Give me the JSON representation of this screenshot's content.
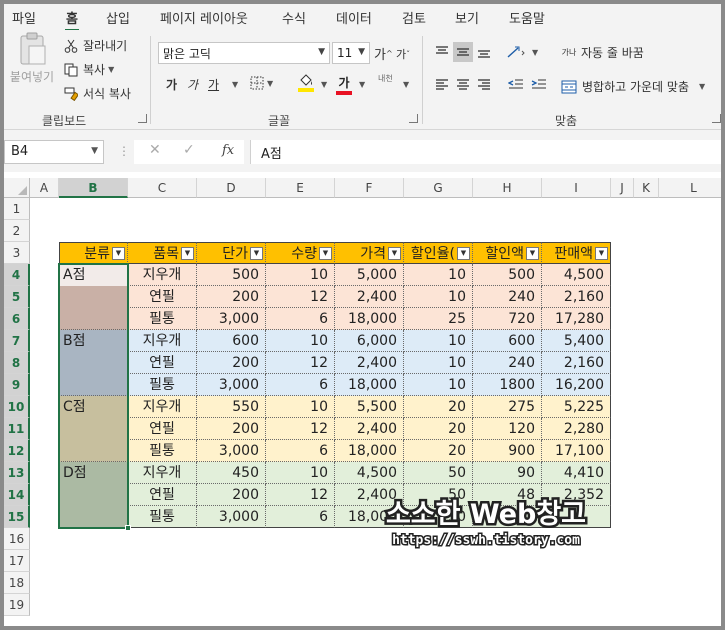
{
  "menu": {
    "tabs": [
      "파일",
      "홈",
      "삽입",
      "페이지 레이아웃",
      "수식",
      "데이터",
      "검토",
      "보기",
      "도움말"
    ],
    "active": "홈"
  },
  "ribbon": {
    "clipboard": {
      "paste_label": "붙여넣기",
      "cut_label": "잘라내기",
      "copy_label": "복사",
      "format_painter_label": "서식 복사",
      "group_label": "클립보드"
    },
    "font": {
      "font_name": "맑은 고딕",
      "font_size": "11",
      "grow_label": "가",
      "shrink_label": "가",
      "bold_label": "가",
      "italic_label": "가",
      "underline_label": "가",
      "font_color_label": "가",
      "phonetic_label": "내천",
      "group_label": "글꼴",
      "fill_color": "#ffe600",
      "font_color": "#e81123"
    },
    "alignment": {
      "wrap_label": "자동 줄 바꿈",
      "merge_label": "병합하고 가운데 맞춤",
      "wrap_icon_text": "가나",
      "group_label": "맞춤"
    }
  },
  "formula_bar": {
    "name_box": "B4",
    "fx_label": "fx",
    "formula": "A점"
  },
  "columns": [
    "A",
    "B",
    "C",
    "D",
    "E",
    "F",
    "G",
    "H",
    "I",
    "J",
    "K",
    "L"
  ],
  "selected_column": "B",
  "rows": [
    "1",
    "2",
    "3",
    "4",
    "5",
    "6",
    "7",
    "8",
    "9",
    "10",
    "11",
    "12",
    "13",
    "14",
    "15",
    "16",
    "17",
    "18",
    "19"
  ],
  "selected_rows": [
    "4",
    "5",
    "6",
    "7",
    "8",
    "9",
    "10",
    "11",
    "12",
    "13",
    "14",
    "15"
  ],
  "table": {
    "headers": [
      "분류",
      "품목",
      "단가",
      "수량",
      "가격",
      "할인율(",
      "할인액",
      "판매액"
    ],
    "rows": [
      [
        "A점",
        "지우개",
        "500",
        "10",
        "5,000",
        "10",
        "500",
        "4,500"
      ],
      [
        "",
        "연필",
        "200",
        "12",
        "2,400",
        "10",
        "240",
        "2,160"
      ],
      [
        "",
        "필통",
        "3,000",
        "6",
        "18,000",
        "25",
        "720",
        "17,280"
      ],
      [
        "B점",
        "지우개",
        "600",
        "10",
        "6,000",
        "10",
        "600",
        "5,400"
      ],
      [
        "",
        "연필",
        "200",
        "12",
        "2,400",
        "10",
        "240",
        "2,160"
      ],
      [
        "",
        "필통",
        "3,000",
        "6",
        "18,000",
        "10",
        "1800",
        "16,200"
      ],
      [
        "C점",
        "지우개",
        "550",
        "10",
        "5,500",
        "20",
        "275",
        "5,225"
      ],
      [
        "",
        "연필",
        "200",
        "12",
        "2,400",
        "20",
        "120",
        "2,280"
      ],
      [
        "",
        "필통",
        "3,000",
        "6",
        "18,000",
        "20",
        "900",
        "17,100"
      ],
      [
        "D점",
        "지우개",
        "450",
        "10",
        "4,500",
        "50",
        "90",
        "4,410"
      ],
      [
        "",
        "연필",
        "200",
        "12",
        "2,400",
        "50",
        "48",
        "2,352"
      ],
      [
        "",
        "필통",
        "3,000",
        "6",
        "18,000",
        "50",
        "",
        ""
      ]
    ],
    "colors": {
      "header": "#ffc000",
      "group_a": "#fce4d6",
      "group_b": "#ddebf7",
      "group_c": "#fff2cc",
      "group_d": "#e2efda",
      "branch_a": "#c9b0a6",
      "branch_b": "#a9b5c2",
      "branch_c": "#c7bf9e",
      "branch_d": "#abbaa3",
      "selection": "#217346"
    }
  },
  "watermark": {
    "title": "소소한 Web창고",
    "url": "https://sswh.tistory.com"
  }
}
